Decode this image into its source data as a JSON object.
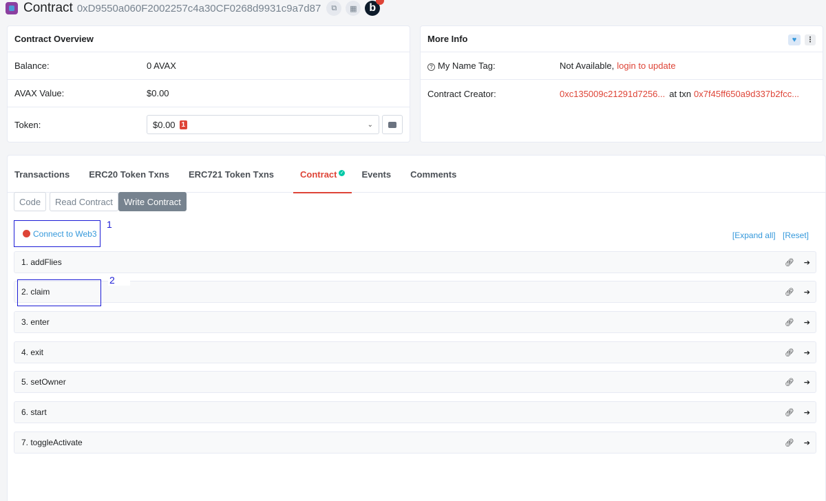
{
  "header": {
    "title": "Contract",
    "address": "0xD9550a060F2002257c4a30CF0268d9931c9a7d87",
    "copy_icon": "copy-icon",
    "qr_icon": "qr-code-icon",
    "badge_letter": "b"
  },
  "overview": {
    "title": "Contract Overview",
    "balance_label": "Balance:",
    "balance_value": "0 AVAX",
    "value_label": "AVAX Value:",
    "value_value": "$0.00",
    "token_label": "Token:",
    "token_value": "$0.00",
    "token_count": "1"
  },
  "more_info": {
    "title": "More Info",
    "name_tag_label": "My Name Tag:",
    "name_tag_value": "Not Available,",
    "name_tag_link": "login to update",
    "creator_label": "Contract Creator:",
    "creator_address": "0xc135009c21291d7256...",
    "at_txn": "at txn",
    "txn_hash": "0x7f45ff650a9d337b2fcc..."
  },
  "tabs": [
    {
      "label": "Transactions"
    },
    {
      "label": "ERC20 Token Txns"
    },
    {
      "label": "ERC721 Token Txns"
    },
    {
      "label": "Contract"
    },
    {
      "label": "Events"
    },
    {
      "label": "Comments"
    }
  ],
  "sub_tabs": {
    "code": "Code",
    "read": "Read Contract",
    "write": "Write Contract"
  },
  "connect_label": "Connect to Web3",
  "annotations": [
    "1",
    "2"
  ],
  "controls": {
    "expand": "[Expand all]",
    "reset": "[Reset]"
  },
  "functions": [
    {
      "label": "1. addFlies"
    },
    {
      "label": "2. claim"
    },
    {
      "label": "3. enter"
    },
    {
      "label": "4. exit"
    },
    {
      "label": "5. setOwner"
    },
    {
      "label": "6. start"
    },
    {
      "label": "7. toggleActivate"
    }
  ],
  "colors": {
    "accent": "#de4437",
    "link_blue": "#3498db",
    "annotation_blue": "#1c1cd6",
    "verified": "#00c9a7"
  }
}
